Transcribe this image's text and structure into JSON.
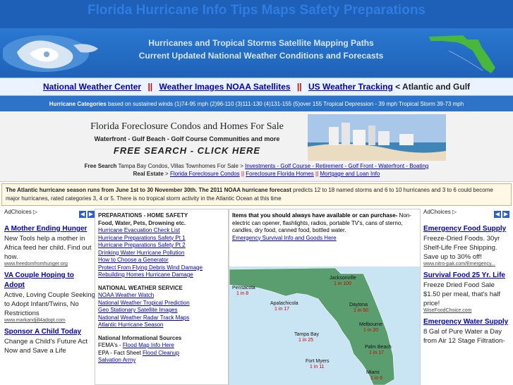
{
  "site": {
    "title": "Florida Hurricane Info Tips Maps Safety Preparations",
    "subtitle1": "Hurricanes and Tropical Storms Satellite Mapping Paths",
    "subtitle2": "Current Updated National Weather Conditions and Forecasts"
  },
  "nav": {
    "link1": "National Weather Center",
    "link2": "Weather Images NOAA Satellites",
    "link3": "US Weather Tracking",
    "separator": "||",
    "tail": "< Atlantic and Gulf"
  },
  "categories": {
    "label": "Hurricane Categories",
    "text": "based on sustained winds (1)74-95 mph (2)96-110 (3)111-130 (4)131-155 (5)over 155 Tropical Depression - 39 mph  Tropical Storm 39-73 mph"
  },
  "promo": {
    "title": "Florida Foreclosure Condos and Homes For Sale",
    "sub1": "Waterfront - Gulf Beach - Golf Course Communities and more",
    "search": "FREE SEARCH - CLICK HERE",
    "free_search_label": "Free Search",
    "free_search_text": "Tampa Bay Condos, Villas Townhomes For Sale >",
    "free_search_link": "Investments - Golf Course - Retirement - Golf Front - Waterfront - Boating",
    "real_estate_label": "Real Estate",
    "real_estate_sep": ">",
    "re_link1": "Florida Foreclosure Condos",
    "re_link2": "Foreclosure Florida Homes",
    "re_link3": "Mortgage and Loan Info",
    "re_separator": "||"
  },
  "info": {
    "bold": "The Atlantic hurricane season runs from June 1st to 30 November 30th. The 2011 NOAA hurricane forecast",
    "text": "predicts 12 to 18 named storms and 6 to 10 hurricanes and 3 to 6 could become major hurricanes, rated categories 3, 4 or 5. There is no tropical storm activity in the Atlantic Ocean at this time"
  },
  "left_ads": {
    "choices": "AdChoices",
    "ads": [
      {
        "title": "A Mother Ending Hunger",
        "body": "New Tools help a mother in Africa feed her child. Find out how.",
        "url": "www.freedomfromhunger.org"
      },
      {
        "title": "VA Couple Hoping to Adopt",
        "body": "Active, Loving Couple Seeking to Adopt Infant/Twins, No Restrictions",
        "url": "www.markandjill4adopt.com"
      },
      {
        "title": "Sponsor A Child Today",
        "body": "Change a Child's Future Act Now and Save a Life",
        "url": ""
      }
    ]
  },
  "right_ads": {
    "choices": "AdChoices",
    "ads": [
      {
        "title": "Emergency Food Supply",
        "body": "Freeze-Dried Foods. 30yr Shelf-Life Free Shipping. Save up to 30% off!",
        "url": "www.nitro-pak.com/Emergency..."
      },
      {
        "title": "Survival Food 25 Yr. Life",
        "body": "Freeze Dried Food Sale $1.50 per meal, that's half price!",
        "url": "WiseFoodChoice.com"
      },
      {
        "title": "Emergency Water Supply",
        "body": "8 Gal of Pure Water a Day from Air 12 Stage Filtration-",
        "url": ""
      }
    ]
  },
  "prep": {
    "head1": "PREPARATIONS - HOME SAFETY",
    "head2": "Food, Water, Pets, Drowning etc.",
    "links": [
      "Hurricane Evacuation Check List",
      "Hurricane Preparations Safety Pt 1",
      "Hurricane Preparations Safety Pt 2",
      "Drinking Water Hurricane Pollution",
      "How to Choose a Generator",
      "Protect From Flying Debris Wind Damage",
      "Rebuilding Homes Hurricane Damage"
    ],
    "head3": "NATIONAL WEATHER SERVICE",
    "nws_links": [
      "NOAA Weather Watch",
      "National Weather Tropical Prediction",
      "Geo Stationary Satellite Images",
      "National Weather Radar Track Maps",
      "Atlantic Hurricane Season"
    ],
    "head4": "National Informational Sources",
    "fema_label": "FEMA's -",
    "fema_link": "Flood Map Info Here",
    "epa_label": "EPA - Fact Sheet",
    "epa_link": "Flood Cleanup",
    "salvation": "Salvation Army"
  },
  "items": {
    "bold": "Items that you should always have available or can purchase-",
    "text": "Non-electric can opener, flashlights, radios, portable TV's, cans of sterno, candles, dry food, canned food, bottled water.",
    "link": "Emergency Survival Info and Goods Here"
  },
  "map": {
    "cities": [
      {
        "name": "Pensacola",
        "odds": "1 in 8"
      },
      {
        "name": "Apalachicola",
        "odds": "1 in 17"
      },
      {
        "name": "Jacksonville",
        "odds": "1 in 100"
      },
      {
        "name": "Daytona",
        "odds": "1 in 50"
      },
      {
        "name": "Melbourne",
        "odds": "1 in 20"
      },
      {
        "name": "Tampa Bay",
        "odds": "1 in 25"
      },
      {
        "name": "Palm Beach",
        "odds": "1 in 17"
      },
      {
        "name": "Fort Myers",
        "odds": "1 in 11"
      },
      {
        "name": "Miami",
        "odds": "1 in 6"
      }
    ],
    "land_color": "#5a9e6f",
    "water_color": "#c9e4f2",
    "label_color": "#cc0000"
  }
}
